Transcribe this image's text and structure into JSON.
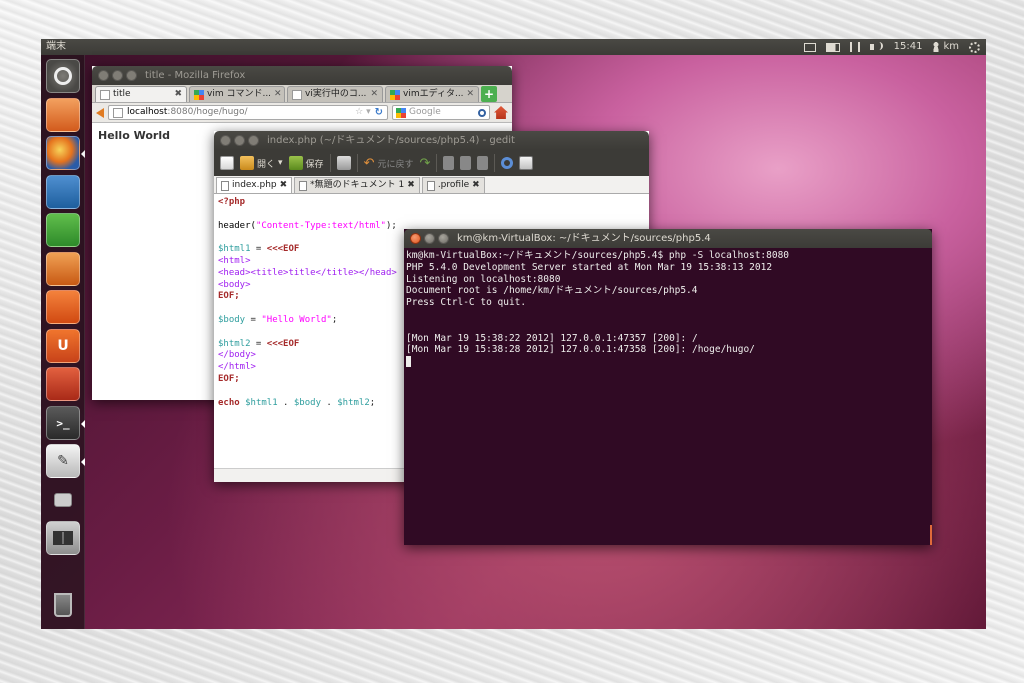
{
  "top_panel": {
    "app_name": "端末",
    "clock": "15:41",
    "user": "km"
  },
  "launcher": {
    "items": [
      "dash-home",
      "home-folder",
      "firefox",
      "libreoffice-writer",
      "libreoffice-calc",
      "libreoffice-impress",
      "ubuntu-software-center",
      "ubuntu-one",
      "system-settings",
      "terminal",
      "gedit",
      "screenshot",
      "workspace-switcher",
      "trash"
    ],
    "ubuntuone_glyph": "U",
    "terminal_glyph": ">_",
    "gedit_glyph": "✎"
  },
  "firefox": {
    "title": "title - Mozilla Firefox",
    "tabs": [
      {
        "label": "title"
      },
      {
        "label": "vim コマンド..."
      },
      {
        "label": "vi実行中のコ..."
      },
      {
        "label": "vimエディタ..."
      }
    ],
    "new_tab": "+",
    "url_host": "localhost",
    "url_rest": ":8080/hoge/hugo/",
    "search_placeholder": "Google",
    "page_text": "Hello World"
  },
  "gedit": {
    "title": "index.php (~/ドキュメント/sources/php5.4) - gedit",
    "toolbar": {
      "open_label": "開く",
      "save_label": "保存",
      "undo_label": "元に戻す"
    },
    "tabs": [
      {
        "label": "index.php"
      },
      {
        "label": "*無題のドキュメント 1"
      },
      {
        "label": ".profile"
      }
    ],
    "close_glyph": "✖"
  },
  "terminal": {
    "title": "km@km-VirtualBox: ~/ドキュメント/sources/php5.4",
    "lines": [
      "km@km-VirtualBox:~/ドキュメント/sources/php5.4$ php -S localhost:8080",
      "PHP 5.4.0 Development Server started at Mon Mar 19 15:38:13 2012",
      "Listening on localhost:8080",
      "Document root is /home/km/ドキュメント/sources/php5.4",
      "Press Ctrl-C to quit.",
      "",
      "",
      "[Mon Mar 19 15:38:22 2012] 127.0.0.1:47357 [200]: /",
      "[Mon Mar 19 15:38:28 2012] 127.0.0.1:47358 [200]: /hoge/hugo/"
    ]
  },
  "code": {
    "l1": "<?php",
    "l3a": "header(",
    "l3b": "\"Content-Type:text/html\"",
    "l3c": ");",
    "l5a": "$html1",
    "l5b": " = ",
    "l5c": "<<<EOF",
    "l6": "<html>",
    "l7": "<head><title>title</title></head>",
    "l8": "<body>",
    "l9": "EOF;",
    "l11a": "$body",
    "l11b": " = ",
    "l11c": "\"Hello World\"",
    "l11d": ";",
    "l13a": "$html2",
    "l13b": " = ",
    "l13c": "<<<EOF",
    "l14": "</body>",
    "l15": "</html>",
    "l16": "EOF;",
    "l18a": "echo",
    "l18b": " $html1",
    "l18c": " . ",
    "l18d": "$body",
    "l18e": " . ",
    "l18f": "$html2",
    "l18g": ";"
  }
}
